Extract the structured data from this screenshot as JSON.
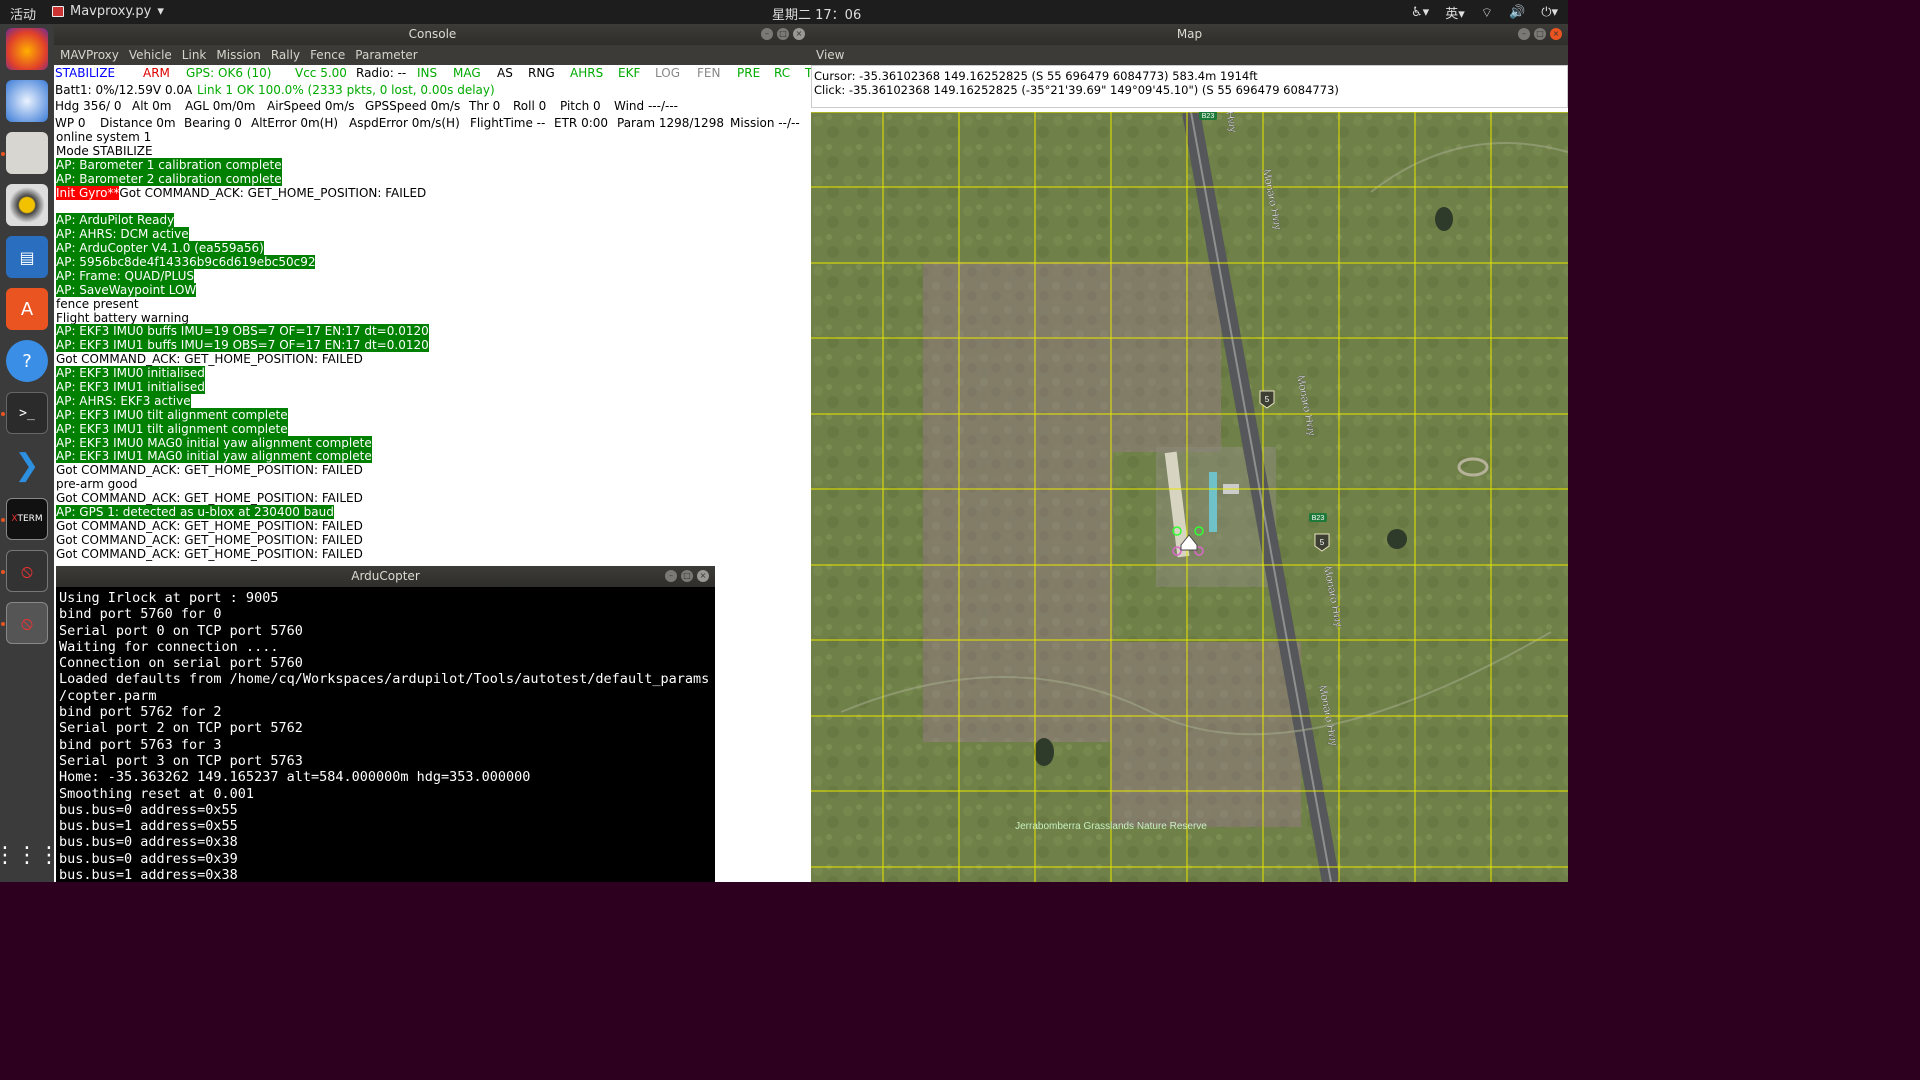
{
  "topbar": {
    "activities": "活动",
    "app_name": "Mavproxy.py",
    "clock": "星期二 17：06",
    "ime": "英"
  },
  "dock": {
    "items": [
      "firefox-icon",
      "thunderbird-icon",
      "files-icon",
      "rhythmbox-icon",
      "writer-icon",
      "software-icon",
      "help-icon",
      "terminal-icon",
      "vscode-icon",
      "xterm-icon",
      "blocked-app-icon",
      "blocked-app-icon"
    ]
  },
  "console": {
    "title": "Console",
    "menu": [
      "MAVProxy",
      "Vehicle",
      "Link",
      "Mission",
      "Rally",
      "Fence",
      "Parameter"
    ],
    "status_row1": [
      {
        "text": "STABILIZE",
        "color": "#0000ff"
      },
      {
        "text": "ARM",
        "color": "#dd0000"
      },
      {
        "text": "GPS: OK6 (10)",
        "color": "#00aa00"
      },
      {
        "text": "Vcc 5.00",
        "color": "#00aa00"
      },
      {
        "text": "Radio: --",
        "color": "#000000"
      },
      {
        "text": "INS",
        "color": "#00aa00"
      },
      {
        "text": "MAG",
        "color": "#00aa00"
      },
      {
        "text": "AS",
        "color": "#000000"
      },
      {
        "text": "RNG",
        "color": "#000000"
      },
      {
        "text": "AHRS",
        "color": "#00aa00"
      },
      {
        "text": "EKF",
        "color": "#00aa00"
      },
      {
        "text": "LOG",
        "color": "#888888"
      },
      {
        "text": "FEN",
        "color": "#888888"
      },
      {
        "text": "PRE",
        "color": "#00aa00"
      },
      {
        "text": "RC",
        "color": "#00aa00"
      },
      {
        "text": "T",
        "color": "#00aa00"
      }
    ],
    "status_row2": [
      {
        "text": "Batt1: 0%/12.59V 0.0A",
        "color": "#000000"
      },
      {
        "text": "Link 1 OK 100.0% (2333 pkts, 0 lost, 0.00s delay)",
        "color": "#00aa00"
      }
    ],
    "status_row3": [
      "Hdg 356/ 0",
      "Alt 0m",
      "AGL 0m/0m",
      "AirSpeed 0m/s",
      "GPSSpeed 0m/s",
      "Thr 0",
      "Roll 0",
      "Pitch 0",
      "Wind ---/---"
    ],
    "status_row4": [
      "WP 0",
      "Distance 0m",
      "Bearing 0",
      "AltError 0m(H)",
      "AspdError 0m/s(H)",
      "FlightTime --",
      "ETR 0:00",
      "Param 1298/1298",
      "Mission --/--"
    ],
    "log": [
      {
        "t": "online system 1"
      },
      {
        "t": "Mode STABILIZE"
      },
      {
        "t": "AP: Barometer 1 calibration complete",
        "s": "green"
      },
      {
        "t": "AP: Barometer 2 calibration complete",
        "s": "green"
      },
      {
        "t": "Init Gyro**",
        "s": "red",
        "rest": "Got COMMAND_ACK: GET_HOME_POSITION: FAILED"
      },
      {
        "t": ""
      },
      {
        "t": "AP: ArduPilot Ready",
        "s": "green"
      },
      {
        "t": "AP: AHRS: DCM active",
        "s": "green"
      },
      {
        "t": "AP: ArduCopter V4.1.0 (ea559a56)",
        "s": "green"
      },
      {
        "t": "AP: 5956bc8de4f14336b9c6d619ebc50c92",
        "s": "green"
      },
      {
        "t": "AP: Frame: QUAD/PLUS",
        "s": "green"
      },
      {
        "t": "AP: SaveWaypoint LOW",
        "s": "green"
      },
      {
        "t": "fence present"
      },
      {
        "t": "Flight battery warning"
      },
      {
        "t": "AP: EKF3 IMU0 buffs IMU=19 OBS=7 OF=17 EN:17 dt=0.0120",
        "s": "green"
      },
      {
        "t": "AP: EKF3 IMU1 buffs IMU=19 OBS=7 OF=17 EN:17 dt=0.0120",
        "s": "green"
      },
      {
        "t": "Got COMMAND_ACK: GET_HOME_POSITION: FAILED"
      },
      {
        "t": "AP: EKF3 IMU0 initialised",
        "s": "green"
      },
      {
        "t": "AP: EKF3 IMU1 initialised",
        "s": "green"
      },
      {
        "t": "AP: AHRS: EKF3 active",
        "s": "green"
      },
      {
        "t": "AP: EKF3 IMU0 tilt alignment complete",
        "s": "green"
      },
      {
        "t": "AP: EKF3 IMU1 tilt alignment complete",
        "s": "green"
      },
      {
        "t": "AP: EKF3 IMU0 MAG0 initial yaw alignment complete",
        "s": "green"
      },
      {
        "t": "AP: EKF3 IMU1 MAG0 initial yaw alignment complete",
        "s": "green"
      },
      {
        "t": "Got COMMAND_ACK: GET_HOME_POSITION: FAILED"
      },
      {
        "t": "pre-arm good"
      },
      {
        "t": "Got COMMAND_ACK: GET_HOME_POSITION: FAILED"
      },
      {
        "t": "AP: GPS 1: detected as u-blox at 230400 baud",
        "s": "green"
      },
      {
        "t": "Got COMMAND_ACK: GET_HOME_POSITION: FAILED"
      },
      {
        "t": "Got COMMAND_ACK: GET_HOME_POSITION: FAILED"
      },
      {
        "t": "Got COMMAND_ACK: GET_HOME_POSITION: FAILED"
      }
    ]
  },
  "arducopter": {
    "title": "ArduCopter",
    "lines": [
      "Using Irlock at port : 9005",
      "bind port 5760 for 0",
      "Serial port 0 on TCP port 5760",
      "Waiting for connection ....",
      "Connection on serial port 5760",
      "Loaded defaults from /home/cq/Workspaces/ardupilot/Tools/autotest/default_params",
      "/copter.parm",
      "bind port 5762 for 2",
      "Serial port 2 on TCP port 5762",
      "bind port 5763 for 3",
      "Serial port 3 on TCP port 5763",
      "Home: -35.363262 149.165237 alt=584.000000m hdg=353.000000",
      "Smoothing reset at 0.001",
      "bus.bus=0 address=0x55",
      "bus.bus=1 address=0x55",
      "bus.bus=0 address=0x38",
      "bus.bus=0 address=0x39",
      "bus.bus=1 address=0x38"
    ]
  },
  "map": {
    "title": "Map",
    "menu": "View",
    "cursor": "Cursor: -35.36102368 149.16252825 (S 55 696479 6084773) 583.4m 1914ft",
    "click": "Click: -35.36102368 149.16252825 (-35°21'39.69\" 149°09'45.10\") (S 55 696479 6084773)",
    "road_labels": [
      "Monaro Hwy",
      "Monaro Hwy",
      "Monaro Hwy",
      "Monaro Hwy",
      "Hwy"
    ],
    "route_badges": [
      "5",
      "5"
    ],
    "highway_badges": [
      "B23",
      "B23"
    ],
    "place_label": "Jerrabomberra Grasslands Nature Reserve",
    "grid_color": "#e8e800"
  }
}
